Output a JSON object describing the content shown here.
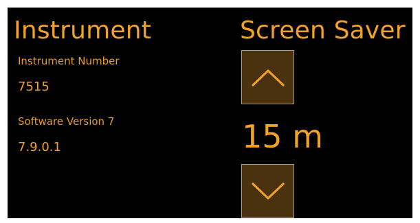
{
  "instrument": {
    "title": "Instrument",
    "number_label": "Instrument Number",
    "number_value": "7515",
    "software_label": "Software Version 7",
    "software_value": "7.9.0.1"
  },
  "screen_saver": {
    "title": "Screen Saver",
    "timeout": "15 m",
    "increase_icon": "chevron-up",
    "decrease_icon": "chevron-down"
  },
  "colors": {
    "background": "#000000",
    "accent": "#f3a229",
    "button_fill": "#4a3210",
    "button_border": "#e39c2f"
  }
}
